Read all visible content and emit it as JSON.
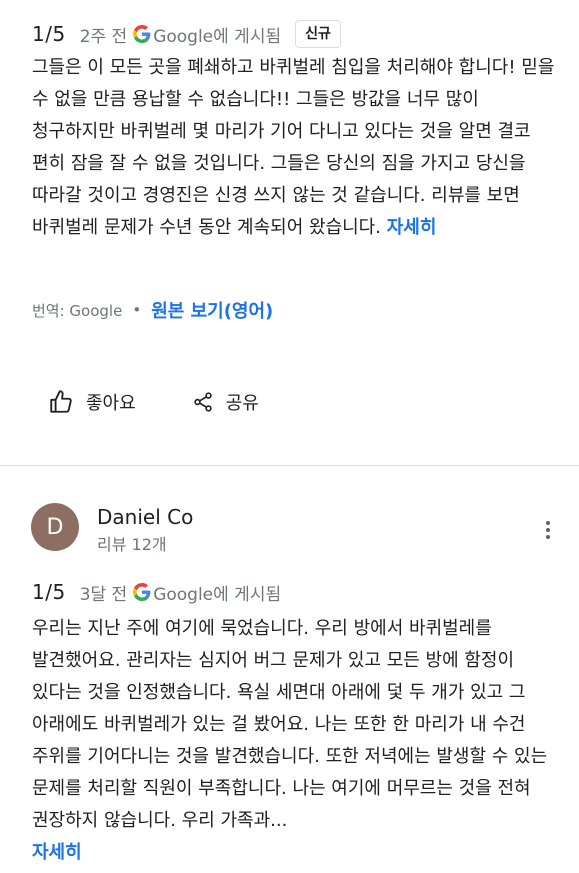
{
  "review1": {
    "rating": "1/5",
    "time": "2주 전",
    "source_suffix": "Google에 게시됨",
    "badge": "신규",
    "text": "그들은 이 모든 곳을 폐쇄하고 바퀴벌레 침입을 처리해야 합니다! 믿을 수 없을 만큼 용납할 수 없습니다!! 그들은 방값을 너무 많이 청구하지만 바퀴벌레 몇 마리가 기어 다니고 있다는 것을 알면 결코 편히 잠을 잘 수 없을 것입니다. 그들은 당신의 짐을 가지고 당신을 따라갈 것이고 경영진은 신경 쓰지 않는 것 같습니다. 리뷰를 보면 바퀴벌레 문제가 수년 동안 계속되어 왔습니다.",
    "more_label": "자세히",
    "translated_by": "번역: Google",
    "original_label": "원본 보기(영어)",
    "like_label": "좋아요",
    "share_label": "공유"
  },
  "review2": {
    "avatar_letter": "D",
    "avatar_color": "#8d6e63",
    "author": "Daniel Co",
    "author_meta": "리뷰 12개",
    "rating": "1/5",
    "time": "3달 전",
    "source_suffix": "Google에 게시됨",
    "text": "우리는 지난 주에 여기에 묵었습니다. 우리 방에서 바퀴벌레를 발견했어요. 관리자는 심지어 버그 문제가 있고 모든 방에 함정이 있다는 것을 인정했습니다. 욕실 세면대 아래에 덫 두 개가 있고 그 아래에도 바퀴벌레가 있는 걸 봤어요. 나는 또한 한 마리가 내 수건 주위를 기어다니는 것을 발견했습니다. 또한 저녁에는 발생할 수 있는 문제를 처리할 직원이 부족합니다. 나는 여기에 머무르는 것을 전혀 권장하지 않습니다. 우리 가족과...",
    "more_label": "자세히"
  },
  "colors": {
    "link": "#1a73e8",
    "muted": "#70757a",
    "divider": "#dadce0"
  },
  "icons": {
    "google": "google-g-icon",
    "like": "thumbs-up-icon",
    "share": "share-icon",
    "menu": "more-vert-icon"
  }
}
